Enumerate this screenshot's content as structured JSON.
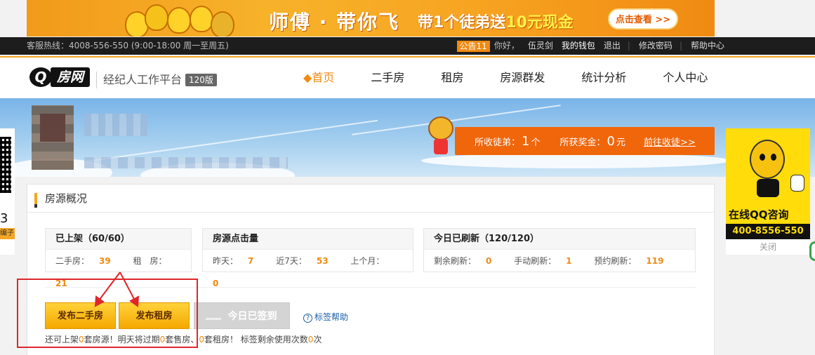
{
  "promo": {
    "headline": "师傅 · 带你飞",
    "sub_prefix": "带1个徒弟送",
    "sub_highlight": "10元现金",
    "cta": "点击查看 >>"
  },
  "topbar": {
    "hotline": "客服热线：4008-556-550 (9:00-18:00 周一至周五)",
    "notice": "公告11",
    "greeting": "你好，",
    "username": "伍灵剑",
    "wallet": "我的钱包",
    "logout": "退出",
    "change_password": "修改密码",
    "help_center": "帮助中心"
  },
  "nav": {
    "logo_q": "Q",
    "logo_text": "房网",
    "platform": "经纪人工作平台",
    "version": "120版",
    "items": [
      {
        "label": "◆首页"
      },
      {
        "label": "二手房"
      },
      {
        "label": "租房"
      },
      {
        "label": "房源群发"
      },
      {
        "label": "统计分析"
      },
      {
        "label": "个人中心"
      }
    ]
  },
  "banner": {
    "apprentices_label": "所收徒弟：",
    "apprentices_value": "1",
    "apprentices_unit": "个",
    "bonus_label": "所获奖金：",
    "bonus_value": "0",
    "bonus_unit": "元",
    "go_link": "前往收徒>>"
  },
  "side_left": {
    "num": "3",
    "tag": "编子"
  },
  "side_right": {
    "title": "在线QQ咨询",
    "phone": "400-8556-550",
    "close": "关闭"
  },
  "overview": {
    "title": "房源概况",
    "listed": {
      "title": "已上架（60/60）",
      "second_hand_label": "二手房：",
      "second_hand_value": "39",
      "rent_label": "租　房：",
      "rent_value": "21"
    },
    "clicks": {
      "title": "房源点击量",
      "yesterday_label": "昨天：",
      "yesterday_value": "7",
      "week_label": "近7天：",
      "week_value": "53",
      "month_label": "上个月：",
      "month_value": "0"
    },
    "refresh": {
      "title": "今日已刷新（120/120）",
      "remaining_label": "剩余刷新：",
      "remaining_value": "0",
      "manual_label": "手动刷新：",
      "manual_value": "1",
      "scheduled_label": "预约刷新：",
      "scheduled_value": "119"
    },
    "buttons": {
      "publish_second_hand": "发布二手房",
      "publish_rent": "发布租房",
      "signed_today": "今日已签到",
      "tag_help": "标签帮助"
    },
    "note": {
      "p1": "还可上架",
      "v1": "0",
      "p2": "套房源！明天将过期",
      "v2": "0",
      "p3": "套售房、",
      "v3": "0",
      "p4": "套租房！ 标签剩余使用次数",
      "v4": "0",
      "p5": "次"
    }
  },
  "colors": {
    "accent": "#f08a12",
    "annotation": "#e0262a"
  }
}
